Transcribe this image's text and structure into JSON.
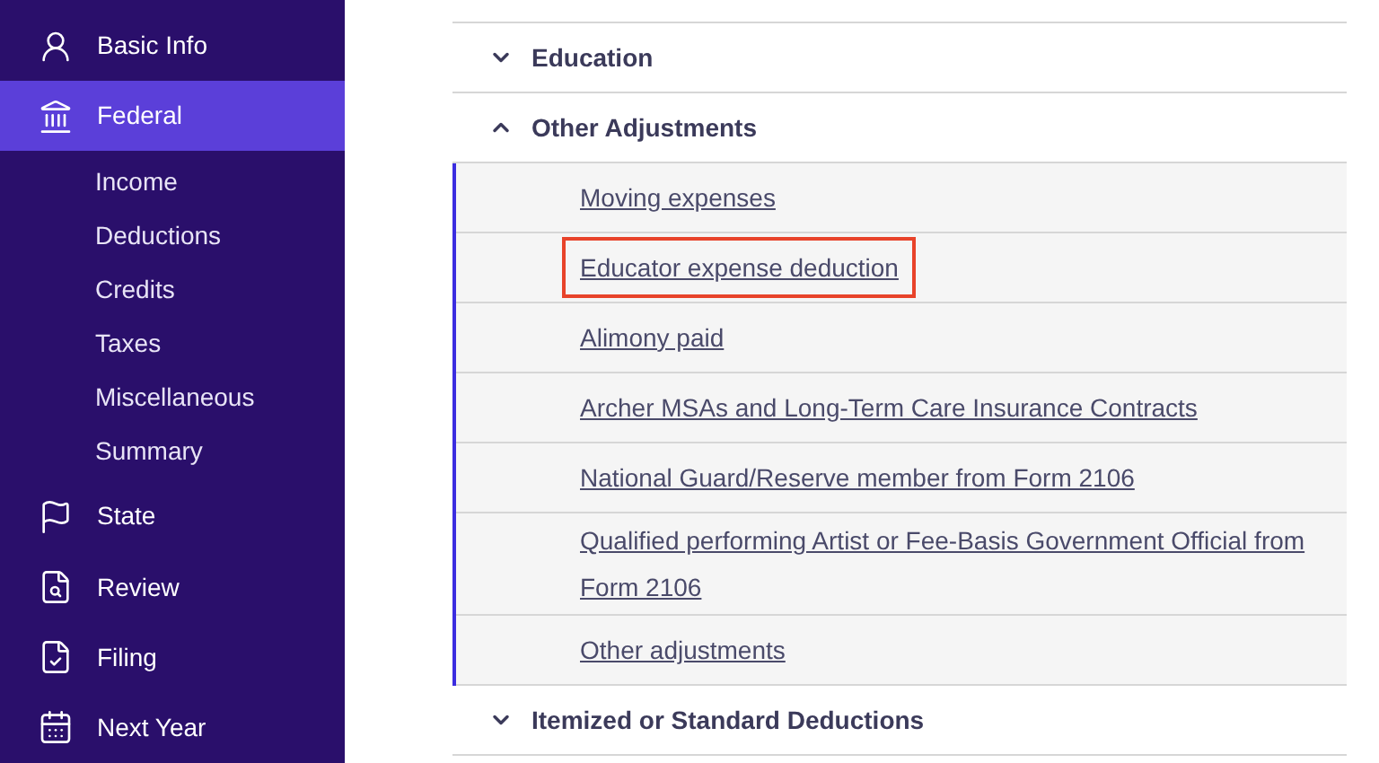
{
  "sidebar": {
    "items": [
      {
        "label": "Basic Info",
        "selected": false
      },
      {
        "label": "Federal",
        "selected": true,
        "children": [
          {
            "label": "Income"
          },
          {
            "label": "Deductions"
          },
          {
            "label": "Credits"
          },
          {
            "label": "Taxes"
          },
          {
            "label": "Miscellaneous"
          },
          {
            "label": "Summary"
          }
        ]
      },
      {
        "label": "State",
        "selected": false
      },
      {
        "label": "Review",
        "selected": false
      },
      {
        "label": "Filing",
        "selected": false
      },
      {
        "label": "Next Year",
        "selected": false
      }
    ]
  },
  "sections": [
    {
      "title": "Education",
      "expanded": false
    },
    {
      "title": "Other Adjustments",
      "expanded": true,
      "links": [
        {
          "label": "Moving expenses",
          "highlighted": false
        },
        {
          "label": "Educator expense deduction",
          "highlighted": true
        },
        {
          "label": "Alimony paid",
          "highlighted": false
        },
        {
          "label": "Archer MSAs and Long-Term Care Insurance Contracts",
          "highlighted": false
        },
        {
          "label": "National Guard/Reserve member from Form 2106",
          "highlighted": false
        },
        {
          "label": "Qualified performing Artist or Fee-Basis Government Official from Form 2106",
          "highlighted": false
        },
        {
          "label": "Other adjustments",
          "highlighted": false
        }
      ]
    },
    {
      "title": "Itemized or Standard Deductions",
      "expanded": false
    }
  ]
}
